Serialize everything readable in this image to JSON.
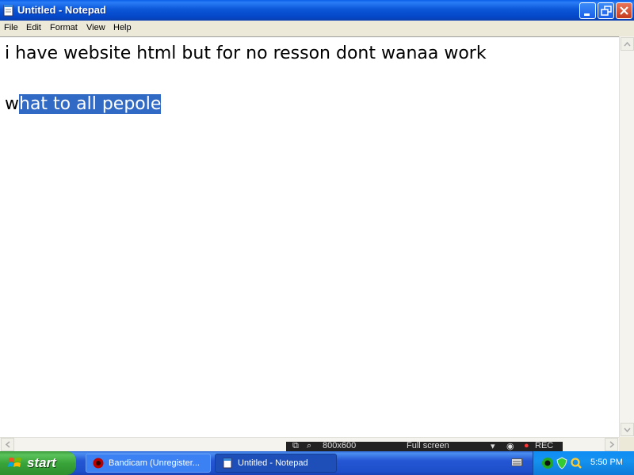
{
  "window": {
    "title": "Untitled - Notepad",
    "icon": "notepad-icon",
    "controls": [
      "minimize-icon",
      "restore-icon",
      "close-icon"
    ]
  },
  "menu": {
    "file": "File",
    "edit": "Edit",
    "format": "Format",
    "view": "View",
    "help": "Help"
  },
  "editor": {
    "line1": "i have website html but for no resson dont wanaa work",
    "line2_prefix": "w",
    "line2_selected": "hat to all pepole"
  },
  "recorder_bar": {
    "size": "800x600",
    "mode": "Full screen",
    "rec": "REC"
  },
  "taskbar": {
    "start_label": "start",
    "tasks": [
      {
        "label": "Bandicam (Unregister...",
        "icon": "bandicam-icon",
        "active": false
      },
      {
        "label": "Untitled - Notepad",
        "icon": "notepad-icon",
        "active": true
      }
    ],
    "clock": "5:50 PM"
  },
  "colors": {
    "selection": "#316ac5",
    "titlebar": "#0b57d8",
    "taskbar": "#2456d3",
    "start_button": "#39a439"
  }
}
